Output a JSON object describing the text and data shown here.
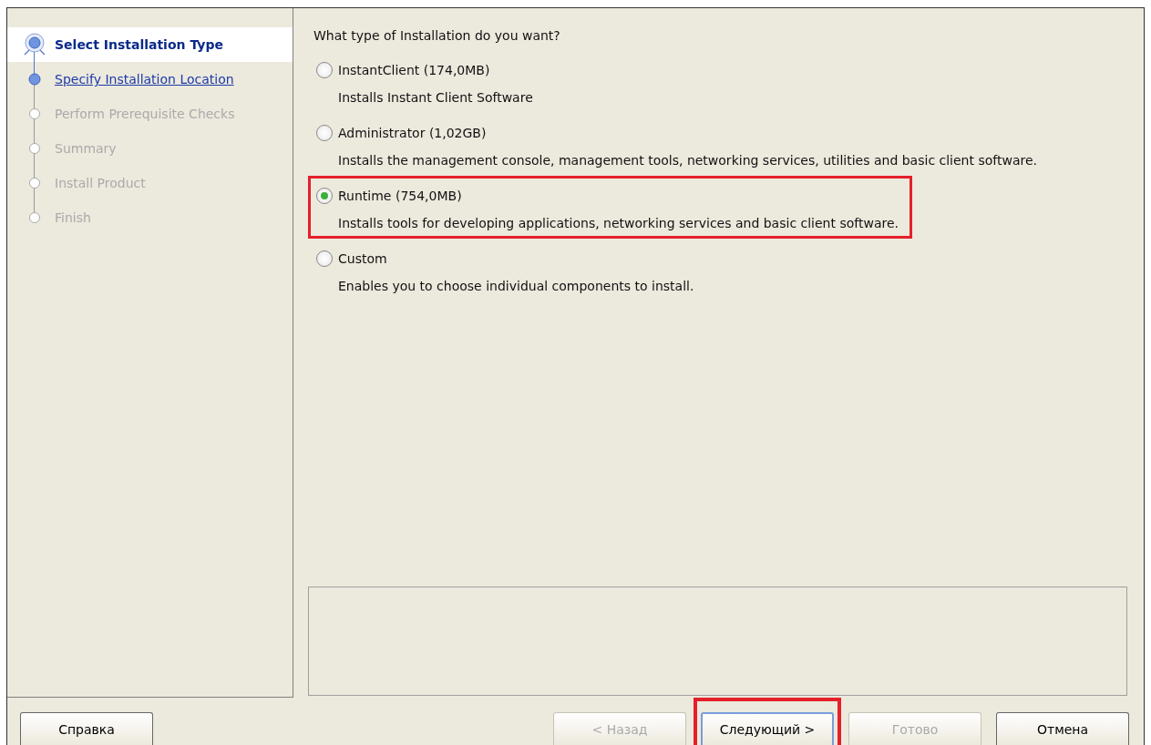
{
  "steps": [
    {
      "label": "Select Installation Type",
      "selected": true,
      "disabled": false
    },
    {
      "label": "Specify Installation Location",
      "selected": false,
      "disabled": false
    },
    {
      "label": "Perform Prerequisite Checks",
      "selected": false,
      "disabled": true
    },
    {
      "label": "Summary",
      "selected": false,
      "disabled": true
    },
    {
      "label": "Install Product",
      "selected": false,
      "disabled": true
    },
    {
      "label": "Finish",
      "selected": false,
      "disabled": true
    }
  ],
  "question": "What type of Installation do you want?",
  "options": [
    {
      "label": "InstantClient (174,0MB)",
      "description": "Installs Instant Client Software",
      "selected": false,
      "highlighted": false
    },
    {
      "label": "Administrator (1,02GB)",
      "description": "Installs the management console, management tools, networking services, utilities and basic client software.",
      "selected": false,
      "highlighted": false
    },
    {
      "label": "Runtime (754,0MB)",
      "description": "Installs tools for developing applications, networking services and basic client software.",
      "selected": true,
      "highlighted": true
    },
    {
      "label": "Custom",
      "description": "Enables you to choose individual components to install.",
      "selected": false,
      "highlighted": false
    }
  ],
  "help_button": {
    "label": "Справка"
  },
  "buttons": [
    {
      "label": "< Назад",
      "disabled": true,
      "default": false,
      "highlighted": false
    },
    {
      "label": "Следующий >",
      "disabled": false,
      "default": true,
      "highlighted": true
    },
    {
      "label": "Готово",
      "disabled": true,
      "default": false,
      "highlighted": false
    },
    {
      "label": "Отмена",
      "disabled": false,
      "default": false,
      "highlighted": false
    }
  ]
}
